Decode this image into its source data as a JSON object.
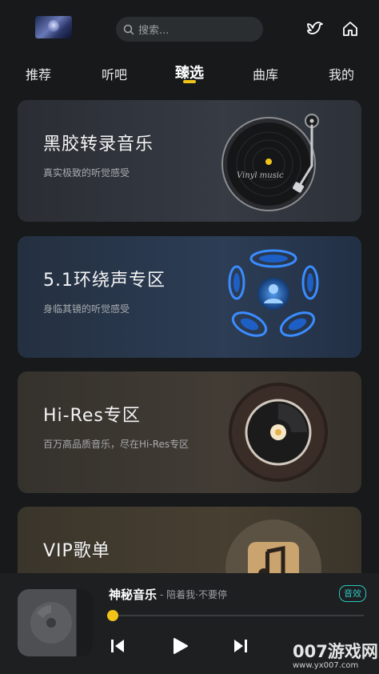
{
  "header": {
    "search_placeholder": "搜索..."
  },
  "tabs": [
    {
      "label": "推荐"
    },
    {
      "label": "听吧"
    },
    {
      "label": "臻选",
      "active": true
    },
    {
      "label": "曲库"
    },
    {
      "label": "我的"
    }
  ],
  "cards": [
    {
      "title": "黑胶转录音乐",
      "subtitle": "真实极致的听觉感受",
      "art_text": "Vinyl music"
    },
    {
      "title": "5.1环绕声专区",
      "subtitle": "身临其镜的听觉感受"
    },
    {
      "title": "Hi-Res专区",
      "subtitle": "百万高品质音乐，尽在Hi-Res专区"
    },
    {
      "title": "VIP歌单"
    }
  ],
  "player": {
    "song": "神秘音乐",
    "artist_line": "- 陪着我·不要停",
    "badge": "音效",
    "progress": 0.0
  },
  "watermark": {
    "text": "007游戏网",
    "url": "www.yx007.com"
  },
  "colors": {
    "accent": "#f0c419",
    "badge": "#2ec7c0",
    "background": "#17191b"
  }
}
